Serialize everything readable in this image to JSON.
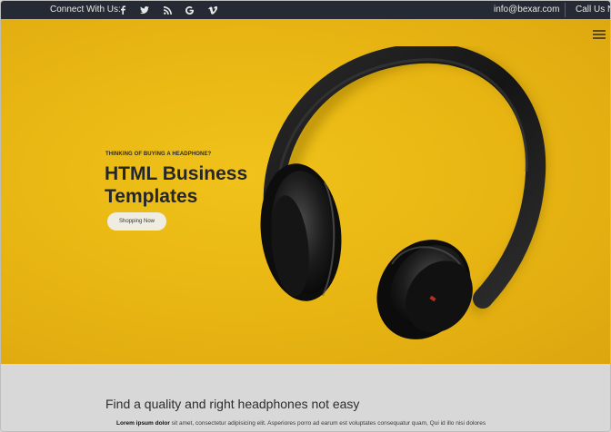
{
  "topbar": {
    "connect_label": "Connect With Us:",
    "social_icons": [
      "facebook-icon",
      "twitter-icon",
      "rss-icon",
      "google-icon",
      "vimeo-icon"
    ],
    "email": "info@bexar.com",
    "call_label": "Call Us No"
  },
  "hero": {
    "eyebrow": "THINKING OF BUYING A HEADPHONE?",
    "title": "HTML Business Templates",
    "button_label": "Shopping Now",
    "background_color": "#e9b713"
  },
  "section": {
    "title": "Find a quality and right headphones not easy",
    "text_bold": "Lorem ipsum dolor",
    "text_rest": " sit amet, consectetur adipisicing elit. Asperiores porro ad earum est voluptates consequatur quam, Qui id illo nisi dolores"
  },
  "colors": {
    "topbar_bg": "#252a34",
    "hero_yellow": "#e9b713",
    "section_bg": "#d8d8d8"
  }
}
